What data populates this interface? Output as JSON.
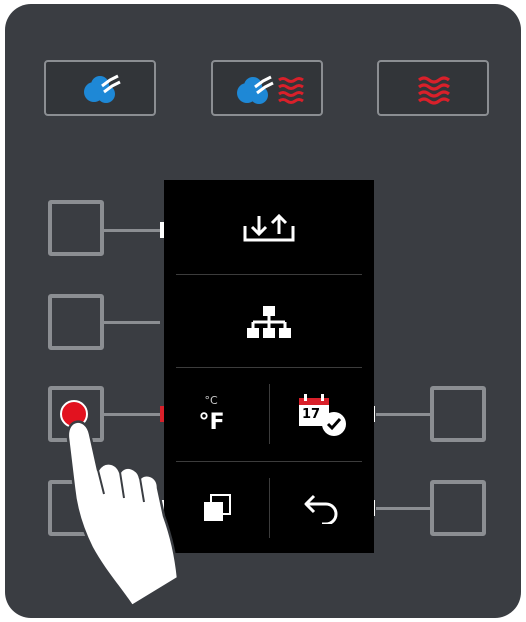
{
  "colors": {
    "panel": "#3a3d42",
    "border": "#8b8e92",
    "steam_blue": "#1e88d6",
    "heat_red": "#d9202a",
    "screen": "#000000",
    "icon": "#ffffff"
  },
  "mode_buttons": [
    {
      "icon": "steam-icon"
    },
    {
      "icon": "combi-steam-heat-icon"
    },
    {
      "icon": "hot-air-icon"
    }
  ],
  "screen": {
    "menu": [
      {
        "icon": "import-export-icon"
      },
      {
        "icon": "network-hierarchy-icon"
      },
      {
        "icon": "temperature-unit-icon"
      },
      {
        "icon": "calendar-schedule-icon"
      },
      {
        "icon": "copy-icon"
      },
      {
        "icon": "back-arrow-icon"
      }
    ],
    "unit_celsius": "°C",
    "unit_fahrenheit": "°F",
    "calendar_day": "17"
  },
  "interaction": {
    "pressed_button": "left-button-3",
    "hand_icon": "pointing-hand-icon"
  }
}
